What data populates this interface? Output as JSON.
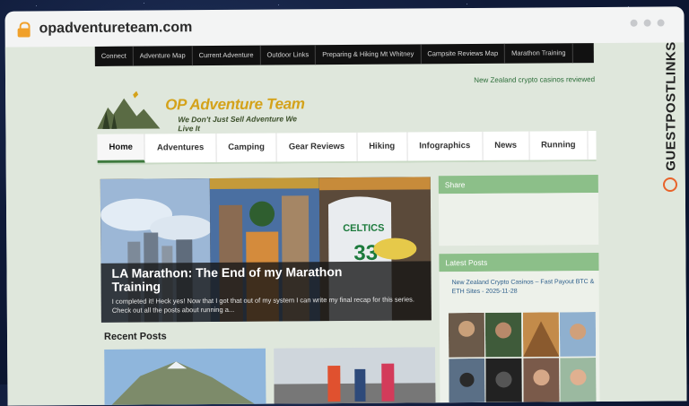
{
  "browser": {
    "url": "opadventureteam.com"
  },
  "site": {
    "top_nav": [
      "Connect",
      "Adventure Map",
      "Current Adventure",
      "Outdoor Links",
      "Preparing & Hiking Mt Whitney",
      "Campsite Reviews Map",
      "Marathon Training"
    ],
    "promo_link": "New Zealand crypto casinos reviewed",
    "logo": {
      "title": "OP Adventure Team",
      "tagline": "We Don't Just Sell Adventure We Live It"
    },
    "main_nav": [
      "Home",
      "Adventures",
      "Camping",
      "Gear Reviews",
      "Hiking",
      "Infographics",
      "News",
      "Running"
    ],
    "hero": {
      "title": "LA Marathon: The End of my Marathon Training",
      "excerpt": "I completed it! Heck yes! Now that I got that out of my system I can write my final recap for this series. Check out all the posts about running a..."
    },
    "recent_posts_heading": "Recent Posts",
    "sidebar": {
      "share_title": "Share",
      "latest_posts_title": "Latest Posts",
      "latest_post_item": "New Zealand Crypto Casinos – Fast Payout BTC & ETH Sites - 2025-11-28"
    }
  },
  "watermark": "GUESTPOSTLINKS",
  "colors": {
    "accent_green": "#8cbf89",
    "nav_active": "#3e7a3e",
    "logo_gold": "#d4a21a",
    "lock_orange": "#f0a02a",
    "brand_orange": "#e8632a"
  }
}
